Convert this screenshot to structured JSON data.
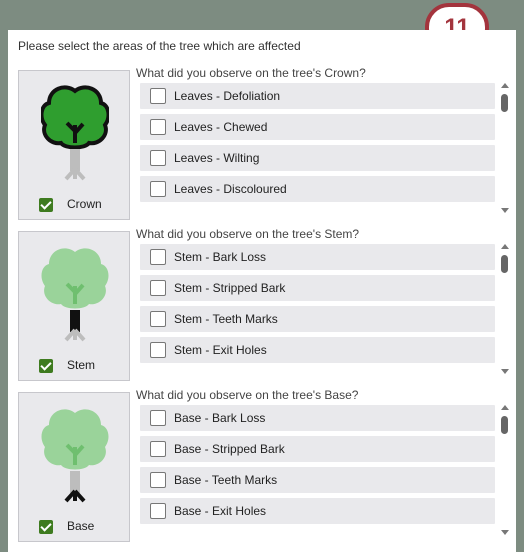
{
  "badge": "11",
  "instruction": "Please select the areas of the tree which are affected",
  "sections": [
    {
      "label": "Crown",
      "checked": true,
      "question": "What did you observe on the tree's Crown?",
      "options": [
        "Leaves - Defoliation",
        "Leaves - Chewed",
        "Leaves - Wilting",
        "Leaves - Discoloured"
      ]
    },
    {
      "label": "Stem",
      "checked": true,
      "question": "What did you observe on the tree's Stem?",
      "options": [
        "Stem - Bark Loss",
        "Stem - Stripped Bark",
        "Stem - Teeth Marks",
        "Stem - Exit Holes"
      ]
    },
    {
      "label": "Base",
      "checked": true,
      "question": "What did you observe on the tree's Base?",
      "options": [
        "Base - Bark Loss",
        "Base - Stripped Bark",
        "Base - Teeth Marks",
        "Base - Exit Holes"
      ]
    }
  ],
  "colors": {
    "highlight": "#1e1e1e",
    "crown_highlight": "#2f9e2f",
    "muted_leaf": "#9ad39a",
    "muted_trunk": "#bdbdbd",
    "checkbox": "#3e7b1f",
    "badge": "#a3343d"
  }
}
